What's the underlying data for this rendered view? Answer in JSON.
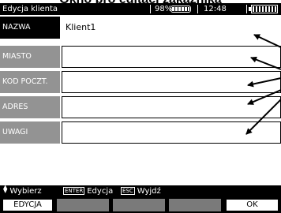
{
  "document_title": "Okno pro editaci zákazníka",
  "statusbar": {
    "title": "Edycja klienta",
    "battery_percent": "98%",
    "time": "12:48",
    "battery_icon": "battery-icon",
    "main_battery_icon": "main-battery-icon"
  },
  "fields": [
    {
      "label": "NAZWA",
      "value": "Klient1",
      "active": true
    },
    {
      "label": "MIASTO",
      "value": "",
      "active": false
    },
    {
      "label": "KOD POCZT.",
      "value": "",
      "active": false
    },
    {
      "label": "ADRES",
      "value": "",
      "active": false
    },
    {
      "label": "UWAGI",
      "value": "",
      "active": false
    }
  ],
  "hints": {
    "select_icon": "up-down-arrows-icon",
    "select_label": "Wybierz",
    "enter_key": "ENTER",
    "edit_label": "Edycja",
    "esc_key": "ESC",
    "exit_label": "Wyjdź"
  },
  "softkeys": {
    "f1": "EDYCJA",
    "f2": "",
    "f3": "",
    "f4": "",
    "f5": "OK"
  },
  "colors": {
    "bar_background": "#000000",
    "label_inactive": "#939393",
    "softkey_blank": "#7a7a7a"
  }
}
